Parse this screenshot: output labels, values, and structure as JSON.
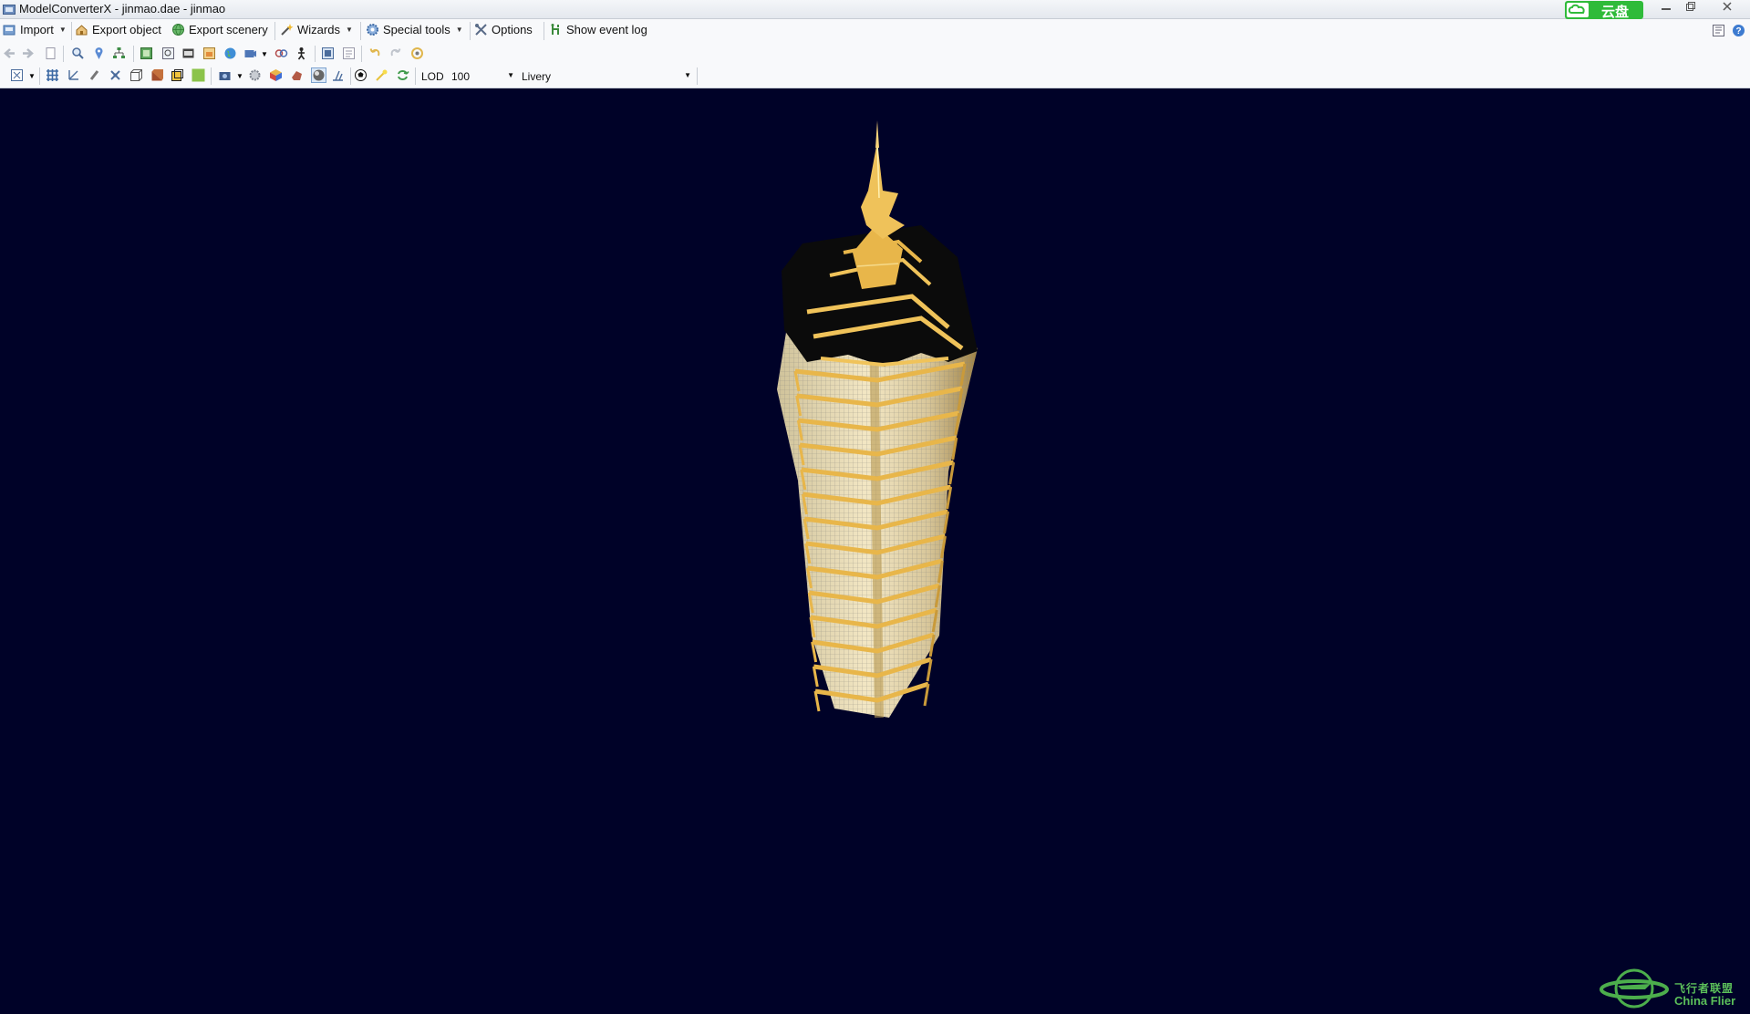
{
  "window": {
    "title": "ModelConverterX - jinmao.dae - jinmao",
    "cloud_label": "云盘",
    "buttons": [
      "minimize",
      "restore",
      "close"
    ]
  },
  "menubar": {
    "items": [
      {
        "label": "Import",
        "icon": "import-icon",
        "dropdown": true
      },
      {
        "label": "Export object",
        "icon": "export-object-icon",
        "dropdown": false
      },
      {
        "label": "Export scenery",
        "icon": "globe-icon",
        "dropdown": false
      },
      {
        "label": "Wizards",
        "icon": "wand-icon",
        "dropdown": true
      },
      {
        "label": "Special tools",
        "icon": "gear-icon",
        "dropdown": true
      },
      {
        "label": "Options",
        "icon": "tools-icon",
        "dropdown": false
      },
      {
        "label": "Show event log",
        "icon": "log-icon",
        "dropdown": false
      }
    ]
  },
  "toolbar2": {
    "lod_label": "LOD",
    "lod_value": "100",
    "livery_value": "Livery"
  },
  "watermark": {
    "cn": "飞行者联盟",
    "en": "China Flier"
  },
  "colors": {
    "viewport_bg": "#000228",
    "tower_gold": "#e8b64a",
    "tower_dark": "#0b0b0b",
    "watermark_green": "#5bbf5a"
  }
}
